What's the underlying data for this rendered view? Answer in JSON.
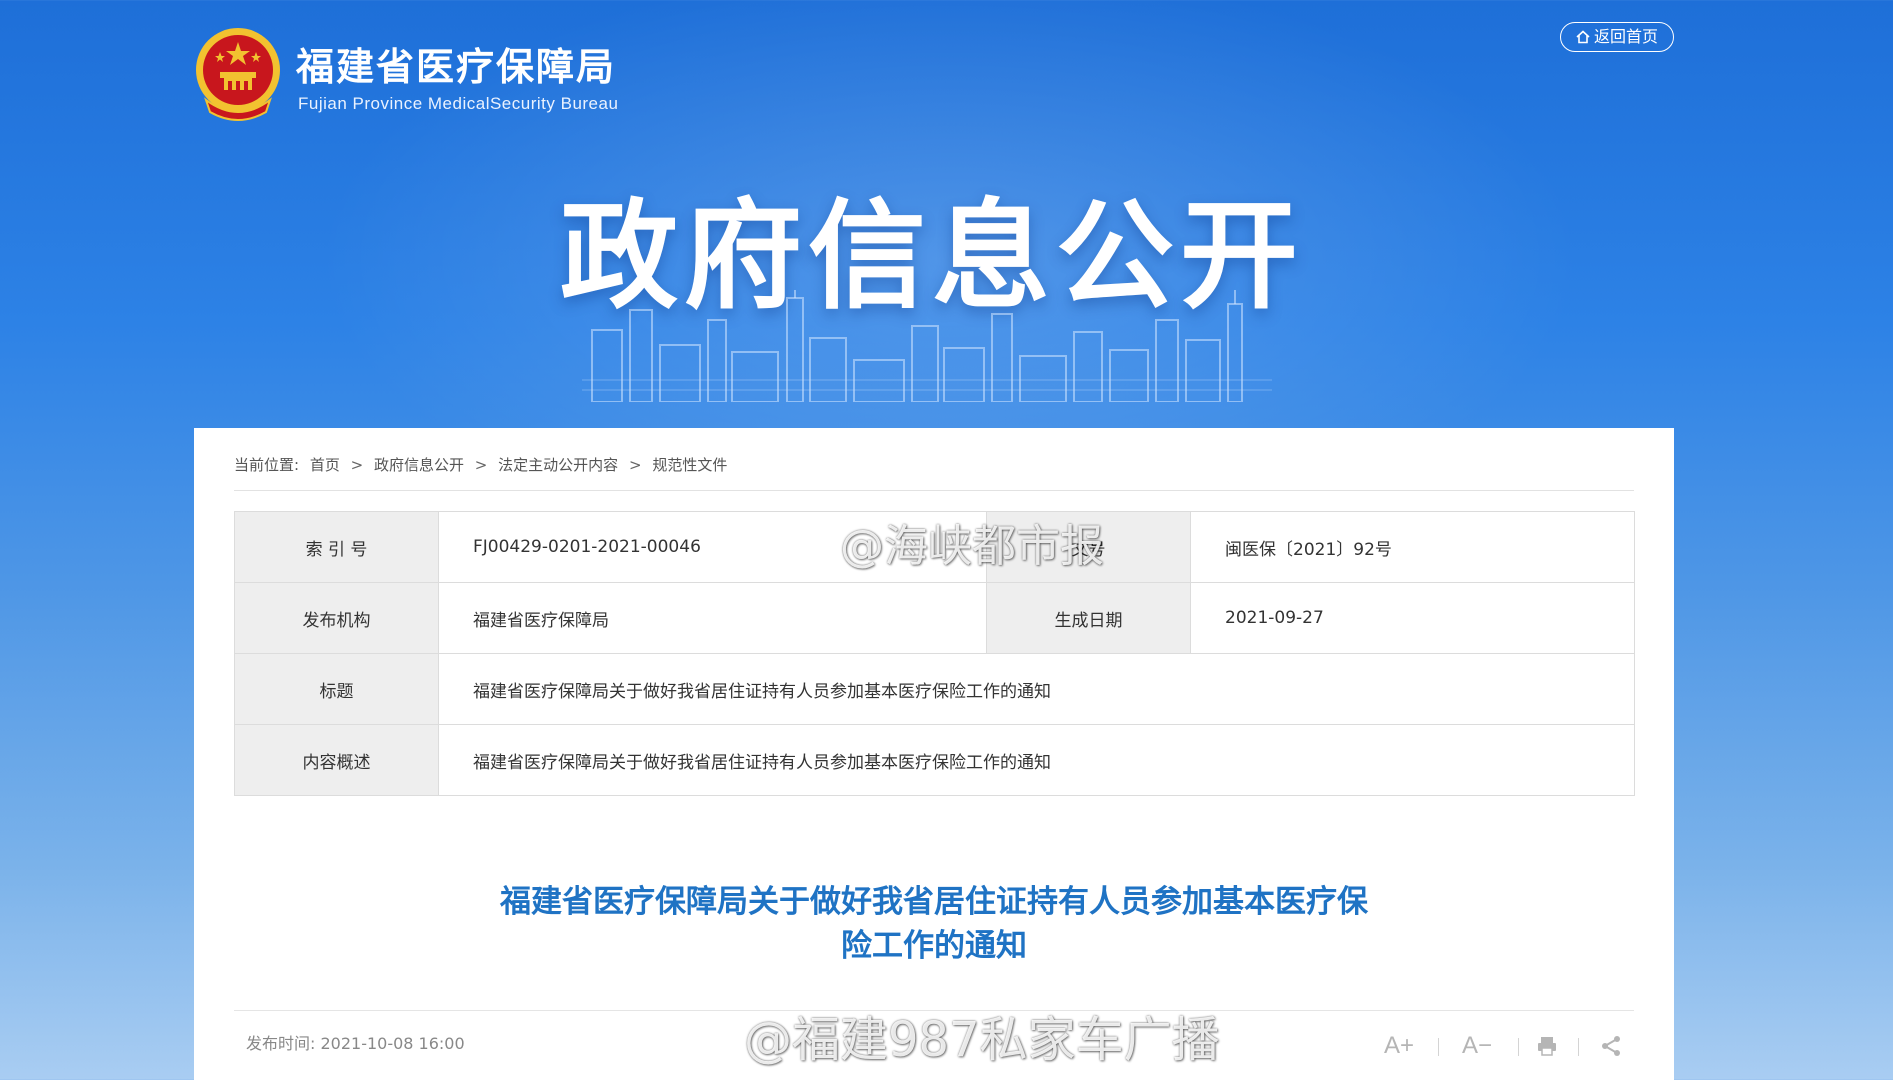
{
  "header": {
    "site_name_cn": "福建省医疗保障局",
    "site_name_en": "Fujian Province MedicalSecurity Bureau",
    "home_button": "返回首页"
  },
  "banner": {
    "title": "政府信息公开"
  },
  "breadcrumb": {
    "label": "当前位置:",
    "items": [
      "首页",
      "政府信息公开",
      "法定主动公开内容",
      "规范性文件"
    ],
    "separator": ">"
  },
  "meta": {
    "index_label": "索 引 号",
    "index_value": "FJ00429-0201-2021-00046",
    "docno_label": "文号",
    "docno_value": "闽医保〔2021〕92号",
    "publisher_label": "发布机构",
    "publisher_value": "福建省医疗保障局",
    "date_label": "生成日期",
    "date_value": "2021-09-27",
    "title_label": "标题",
    "title_value": "福建省医疗保障局关于做好我省居住证持有人员参加基本医疗保险工作的通知",
    "summary_label": "内容概述",
    "summary_value": "福建省医疗保障局关于做好我省居住证持有人员参加基本医疗保险工作的通知"
  },
  "article": {
    "title_line1": "福建省医疗保障局关于做好我省居住证持有人员参加基本医疗保",
    "title_line2": "险工作的通知",
    "publish_time": "发布时间:  2021-10-08 16:00"
  },
  "tools": {
    "font_increase": "A+",
    "font_decrease": "A−"
  },
  "watermarks": {
    "top": "@海峡都市报",
    "bottom": "@福建987私家车广播"
  },
  "colors": {
    "accent_blue": "#1f73c4",
    "header_bg": "#2d82e6",
    "emblem_red": "#c8161d",
    "emblem_gold": "#f2c230"
  }
}
